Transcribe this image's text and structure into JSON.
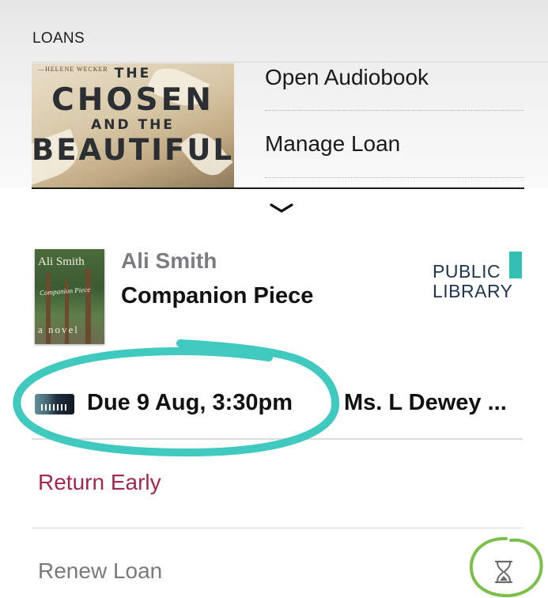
{
  "section": {
    "label": "LOANS"
  },
  "featured_book": {
    "cover_author": "—HELENE WECKER",
    "cover_title_lines": [
      "THE",
      "CHOSEN",
      "AND THE",
      "BEAUTIFUL"
    ]
  },
  "menu": {
    "open_audiobook": "Open Audiobook",
    "manage_loan": "Manage Loan"
  },
  "loan": {
    "author": "Ali Smith",
    "title": "Companion Piece",
    "cover_author": "Ali Smith",
    "cover_title": "Companion Piece",
    "cover_subtitle": "a novel",
    "due": "Due 9 Aug, 3:30pm",
    "owner": "Ms. L Dewey ...",
    "library_line1": "PUBLIC",
    "library_line2": "LIBRARY"
  },
  "actions": {
    "return_early": "Return Early",
    "renew_loan": "Renew Loan"
  },
  "colors": {
    "return_early": "#a3284d",
    "library_accent": "#35bfb0",
    "circle_annotation": "#3fc9bf",
    "hourglass_annotation": "#7cc04a"
  },
  "icons": {
    "collapse": "chevron-down-icon",
    "loan_format": "audiobook-icon",
    "renew_status": "hourglass-icon"
  }
}
